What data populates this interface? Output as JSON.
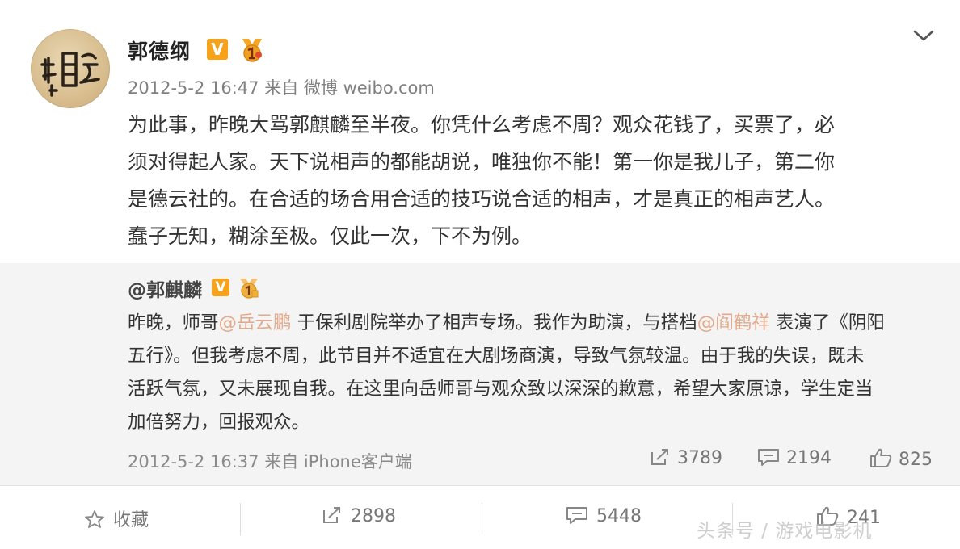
{
  "post": {
    "author": "郭德纲",
    "verified_badge": "V",
    "timestamp": "2012-5-2 16:47",
    "source_prefix": "来自",
    "source": "微博 weibo.com",
    "lines": [
      "为此事，昨晚大骂郭麒麟至半夜。你凭什么考虑不周？观众花钱了，买票了，必",
      "须对得起人家。天下说相声的都能胡说，唯独你不能！第一你是我儿子，第二你",
      "是德云社的。在合适的场合用合适的技巧说合适的相声，才是真正的相声艺人。",
      "蠢子无知，糊涂至极。仅此一次，下不为例。"
    ]
  },
  "repost": {
    "user": "@郭麒麟",
    "verified_badge": "V",
    "line1_a": "昨晚，师哥",
    "mention1": "@岳云鹏",
    "line1_b": " 于保利剧院举办了相声专场。我作为助演，与搭档",
    "mention2": "@阎鹤祥",
    "line1_c": " 表演了《阴阳",
    "lines_rest": [
      "五行》。但我考虑不周，此节目并不适宜在大剧场商演，导致气氛较温。由于我的失误，既未",
      "活跃气氛，又未展现自我。在这里向岳师哥与观众致以深深的歉意，希望大家原谅，学生定当",
      "加倍努力，回报观众。"
    ],
    "timestamp": "2012-5-2 16:37",
    "source_prefix": "来自",
    "source": "iPhone客户端",
    "reposts": "3789",
    "comments": "2194",
    "likes": "825"
  },
  "action_bar": {
    "favorite_label": "收藏",
    "reposts": "2898",
    "comments": "5448",
    "likes": "241"
  },
  "watermark": "头条号 / 游戏电影机",
  "icons": {
    "chevron": "chevron-down-icon",
    "medal": "medal-icon",
    "repost": "repost-icon",
    "comment": "comment-icon",
    "like": "thumbs-up-icon",
    "favorite": "star-icon"
  },
  "colors": {
    "verified_badge": "#f7a21a",
    "mention": "#e3a98a",
    "repost_bg": "#f4f4f4"
  }
}
